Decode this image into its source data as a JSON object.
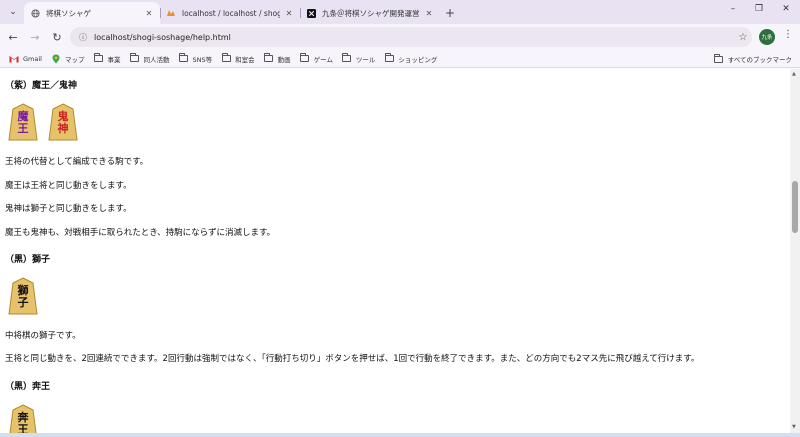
{
  "tabs": [
    {
      "title": "将棋ソシャゲ",
      "active": true,
      "icon": "globe-icon"
    },
    {
      "title": "localhost / localhost / shogi_so",
      "active": false,
      "icon": "phpmyadmin-icon"
    },
    {
      "title": "九条＠将棋ソシャゲ開発運営室",
      "active": false,
      "icon": "x-logo-icon"
    }
  ],
  "window_controls": {
    "minimize": "–",
    "maximize": "❐",
    "close": "✕"
  },
  "address_bar": {
    "url": "localhost/shogi-soshage/help.html"
  },
  "profile": {
    "initials": "九条"
  },
  "bookmarks": [
    {
      "label": "Gmail",
      "icon": "gmail-icon"
    },
    {
      "label": "マップ",
      "icon": "maps-icon"
    },
    {
      "label": "事業",
      "icon": "folder-icon"
    },
    {
      "label": "同人活動",
      "icon": "folder-icon"
    },
    {
      "label": "SNS等",
      "icon": "folder-icon"
    },
    {
      "label": "和室会",
      "icon": "folder-icon"
    },
    {
      "label": "動画",
      "icon": "folder-icon"
    },
    {
      "label": "ゲーム",
      "icon": "folder-icon"
    },
    {
      "label": "ツール",
      "icon": "folder-icon"
    },
    {
      "label": "ショッピング",
      "icon": "folder-icon"
    }
  ],
  "all_bookmarks": "すべてのブックマーク",
  "content": {
    "sections": [
      {
        "heading": "（紫）魔王／鬼神",
        "pieces": [
          {
            "kanji_top": "魔",
            "kanji_bottom": "王",
            "color": "#7a1fa0"
          },
          {
            "kanji_top": "鬼",
            "kanji_bottom": "神",
            "color": "#cc2222"
          }
        ],
        "paragraphs": [
          "王将の代替として編成できる駒です。",
          "魔王は王将と同じ動きをします。",
          "鬼神は獅子と同じ動きをします。",
          "魔王も鬼神も、対戦相手に取られたとき、持駒にならずに消滅します。"
        ]
      },
      {
        "heading": "（黒）獅子",
        "pieces": [
          {
            "kanji_top": "獅",
            "kanji_bottom": "子",
            "color": "#111111"
          }
        ],
        "paragraphs": [
          "中将棋の獅子です。",
          "王将と同じ動きを、2回連続でできます。2回行動は強制ではなく、「行動打ち切り」ボタンを押せば、1回で行動を終了できます。また、どの方向でも2マス先に飛び越えて行けます。"
        ]
      },
      {
        "heading": "（黒）奔王",
        "pieces": [
          {
            "kanji_top": "奔",
            "kanji_bottom": "王",
            "color": "#111111"
          }
        ],
        "paragraphs": []
      }
    ]
  },
  "colors": {
    "tabstrip_bg": "#e8e2f2",
    "toolbar_bg": "#f7f4fb",
    "piece_wood": "#e6c36a"
  }
}
